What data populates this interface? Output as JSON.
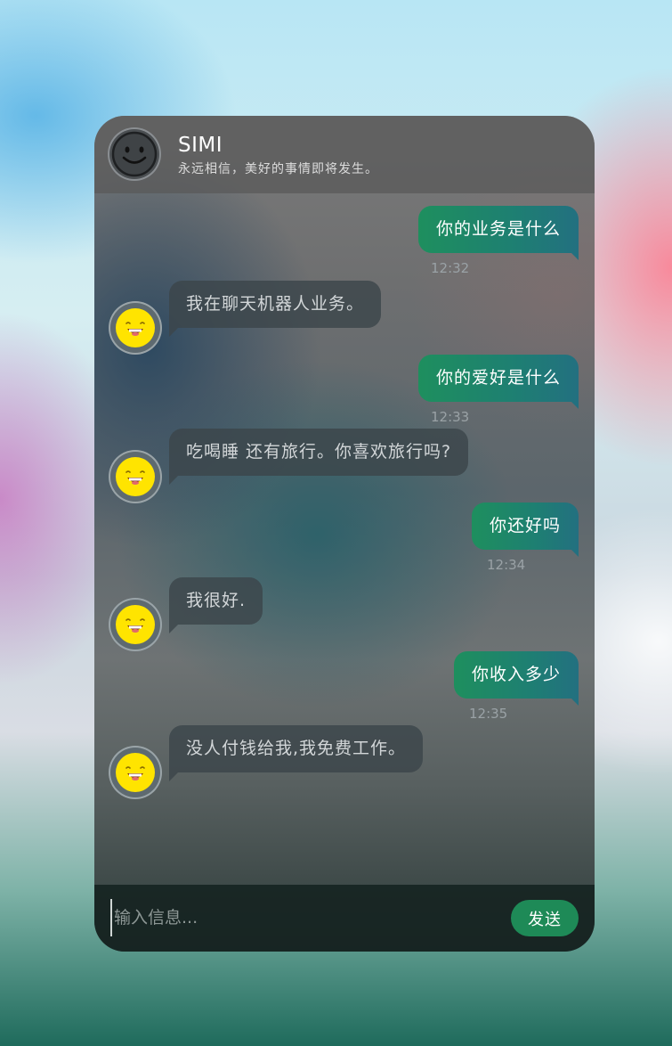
{
  "background_colors": {
    "accent": "#1e8a57",
    "bubble_out": "#1e8f5e",
    "bubble_in": "#3c464a"
  },
  "header": {
    "title": "SIMI",
    "subtitle": "永远相信，美好的事情即将发生。",
    "avatar_icon": "smiley-face-icon"
  },
  "messages": [
    {
      "from": "user",
      "text": "你的业务是什么",
      "time": "12:32"
    },
    {
      "from": "bot",
      "text": "我在聊天机器人业务。",
      "avatar_icon": "yellow-smiley-icon"
    },
    {
      "from": "user",
      "text": "你的爱好是什么",
      "time": "12:33"
    },
    {
      "from": "bot",
      "text": "吃喝睡 还有旅行。你喜欢旅行吗?",
      "avatar_icon": "yellow-smiley-icon"
    },
    {
      "from": "user",
      "text": "你还好吗",
      "time": "12:34"
    },
    {
      "from": "bot",
      "text": "我很好.",
      "avatar_icon": "yellow-smiley-icon"
    },
    {
      "from": "user",
      "text": "你收入多少",
      "time": "12:35"
    },
    {
      "from": "bot",
      "text": "没人付钱给我,我免费工作。",
      "avatar_icon": "yellow-smiley-icon"
    }
  ],
  "composer": {
    "placeholder": "输入信息...",
    "send_label": "发送"
  }
}
